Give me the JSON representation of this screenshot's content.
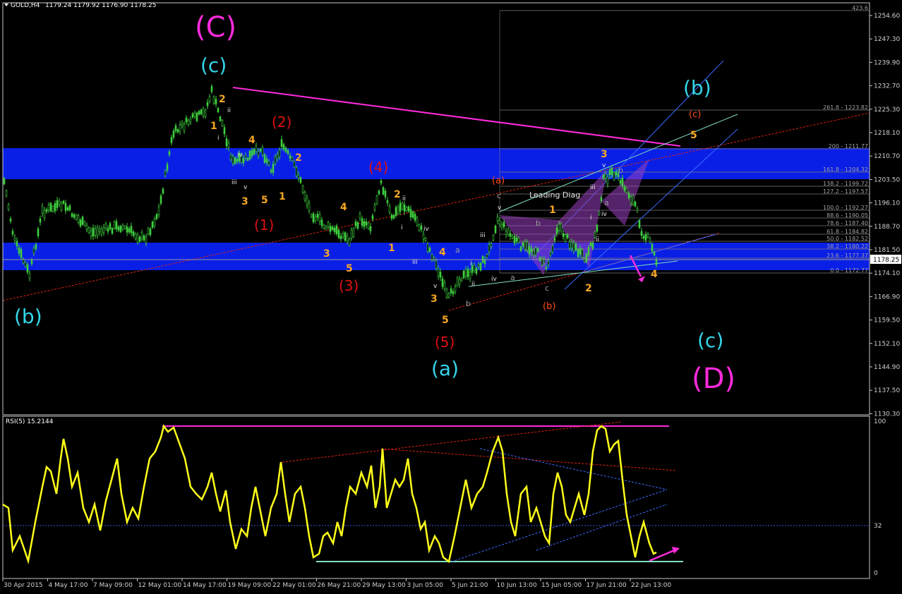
{
  "header": {
    "symbol": "GOLD,H4",
    "ohlc": "1179.24 1179.92 1176.90 1178.25",
    "current_price": "1178.25"
  },
  "price_axis": [
    "1254.60",
    "1247.30",
    "1239.90",
    "1232.70",
    "1225.30",
    "1218.10",
    "1210.70",
    "1203.50",
    "1196.10",
    "1188.70",
    "1181.50",
    "1174.10",
    "1166.90",
    "1159.50",
    "1152.10",
    "1144.90",
    "1137.50",
    "1130.30"
  ],
  "rsi": {
    "label": "RSI(5) 15.2144",
    "levels": [
      "100",
      "32",
      "0"
    ]
  },
  "time_axis": [
    "30 Apr 2015",
    "4 May 17:00",
    "7 May 09:00",
    "12 May 01:00",
    "14 May 17:00",
    "19 May 09:00",
    "22 May 01:00",
    "26 May 21:00",
    "29 May 13:00",
    "3 Jun 05:00",
    "5 Jun 21:00",
    "10 Jun 13:00",
    "15 Jun 05:00",
    "17 Jun 21:00",
    "22 Jun 13:00"
  ],
  "fib_levels": [
    {
      "label": "423.6"
    },
    {
      "label": "261.8 - 1223.82"
    },
    {
      "label": "200 - 1211.77"
    },
    {
      "label": "161.8 - 1204.32"
    },
    {
      "label": "138.2 - 1199.72"
    },
    {
      "label": "127.2 - 1197.57"
    },
    {
      "label": "100.0 - 1192.27"
    },
    {
      "label": "88.6 - 1190.05"
    },
    {
      "label": "78.6 - 1187.40"
    },
    {
      "label": "61.8 - 1184.82"
    },
    {
      "label": "50.0 - 1182.52"
    },
    {
      "label": "38.2 - 1180.22"
    },
    {
      "label": "23.6 - 1177.37"
    },
    {
      "label": "0.0 - 1172.77"
    }
  ],
  "pattern_label": "Leading Diag",
  "wave_labels": {
    "C_big": "(C)",
    "D_big": "(D)",
    "c_top": "(c)",
    "b_left": "(b)",
    "a_bot": "(a)",
    "b_right": "(b)",
    "c_right": "(c)",
    "p1": "(1)",
    "p2": "(2)",
    "p3": "(3)",
    "p4": "(4)",
    "p5": "(5)",
    "oa": "(a)",
    "ob": "(b)",
    "oc": "(c)"
  },
  "colors": {
    "background": "#000000",
    "candles": "#3ecf3e",
    "zone": "#0a1fe6",
    "trend_magenta": "#ff2bdc",
    "rsi_line": "#ffff1a",
    "wave_orange": "#f5a623",
    "wave_red": "#e01010",
    "wave_cyan": "#33d6e8"
  }
}
